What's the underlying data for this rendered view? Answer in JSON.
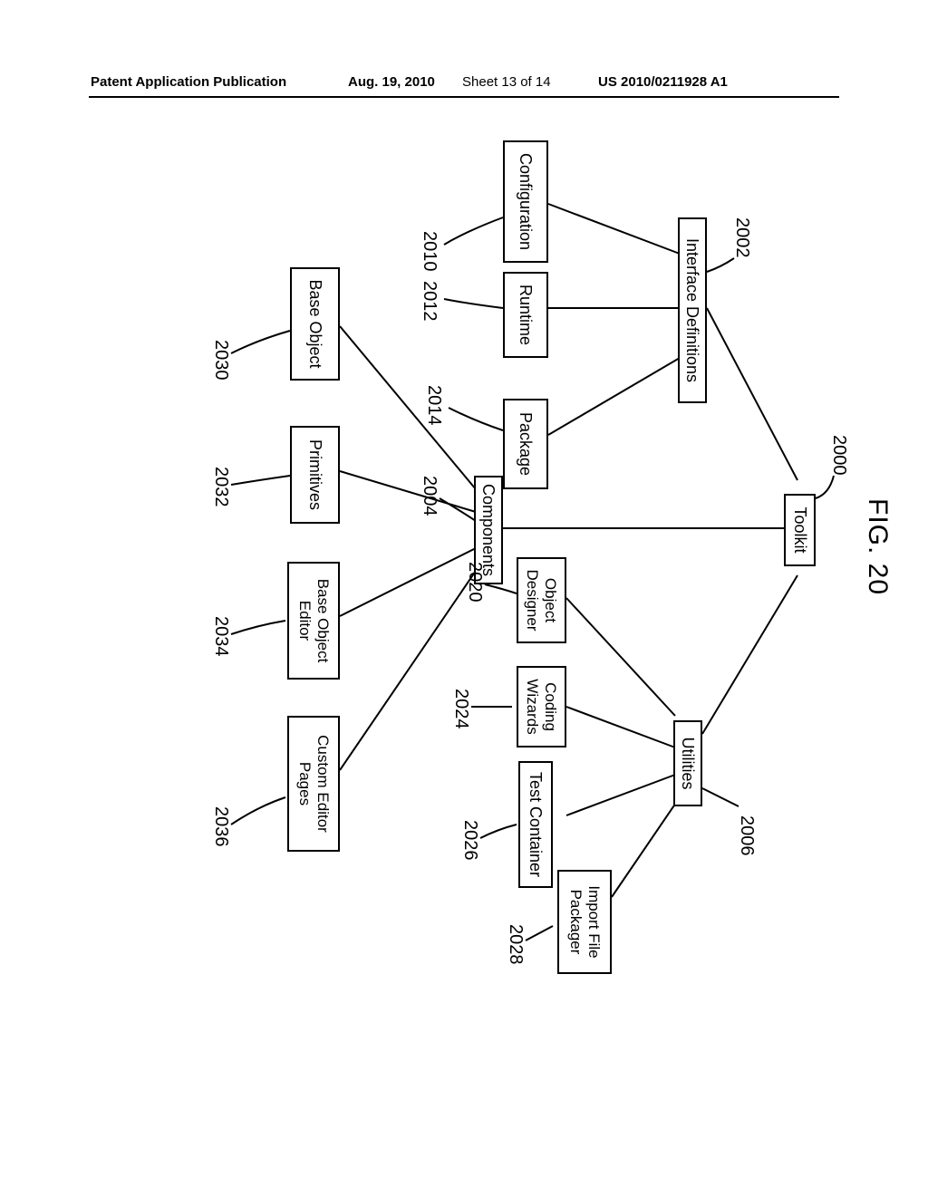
{
  "header": {
    "left": "Patent Application Publication",
    "date": "Aug. 19, 2010",
    "sheet": "Sheet 13 of 14",
    "pubno": "US 2010/0211928 A1"
  },
  "figure": {
    "title": "FIG. 20"
  },
  "nodes": {
    "toolkit": "Toolkit",
    "interface_definitions": "Interface Definitions",
    "utilities": "Utilities",
    "configuration": "Configuration",
    "runtime": "Runtime",
    "package": "Package",
    "object_designer": "Object\nDesigner",
    "coding_wizards": "Coding\nWizards",
    "test_container": "Test Container",
    "import_file_packager": "Import File\nPackager",
    "components": "Components",
    "base_object": "Base Object",
    "primitives": "Primitives",
    "base_object_editor": "Base Object\nEditor",
    "custom_editor_pages": "Custom Editor\nPages"
  },
  "refs": {
    "r2000": "2000",
    "r2002": "2002",
    "r2004": "2004",
    "r2006": "2006",
    "r2010": "2010",
    "r2012": "2012",
    "r2014": "2014",
    "r2020": "2020",
    "r2024": "2024",
    "r2026": "2026",
    "r2028": "2028",
    "r2030": "2030",
    "r2032": "2032",
    "r2034": "2034",
    "r2036": "2036"
  }
}
